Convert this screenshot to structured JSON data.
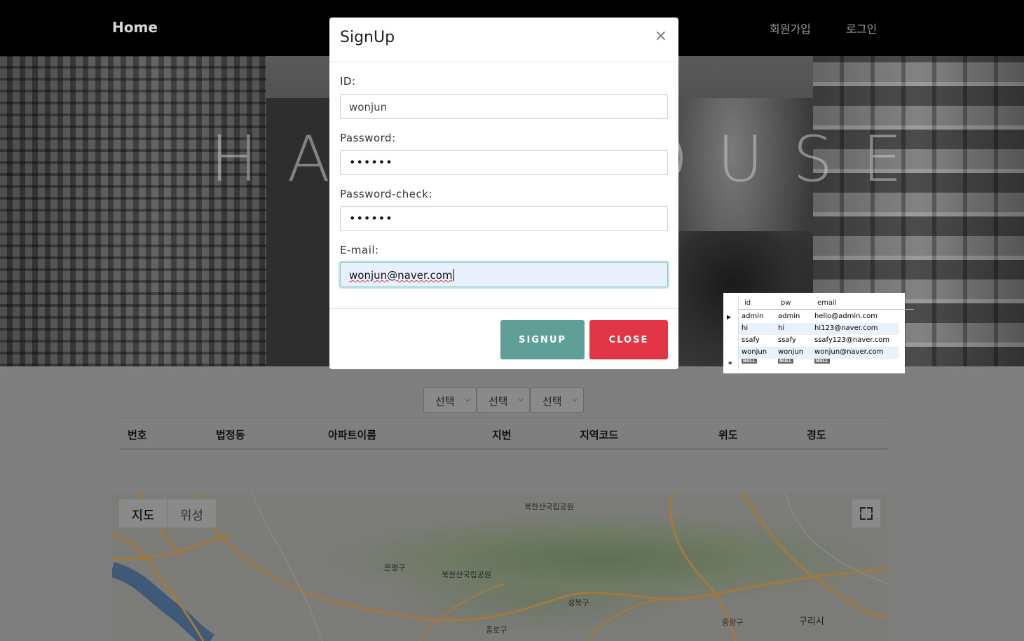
{
  "navbar": {
    "home": "Home",
    "signup": "회원가입",
    "login": "로그인"
  },
  "hero": {
    "title": "HAPPYHOUSE"
  },
  "filters": {
    "select1": "선택",
    "select2": "선택",
    "select3": "선택"
  },
  "table": {
    "headers": [
      "번호",
      "법정동",
      "아파트이름",
      "지번",
      "지역코드",
      "위도",
      "경도"
    ]
  },
  "map": {
    "type_map": "지도",
    "type_satellite": "위성",
    "labels": [
      "북한산국립공원",
      "은평구",
      "북한산국립공원",
      "성북구",
      "종로구",
      "중랑구",
      "구리시"
    ]
  },
  "modal": {
    "title": "SignUp",
    "close_symbol": "×",
    "id_label": "ID:",
    "id_value": "wonjun",
    "password_label": "Password:",
    "password_value": "••••••",
    "password_check_label": "Password-check:",
    "password_check_value": "••••••",
    "email_label": "E-mail:",
    "email_value": "wonjun@naver.com",
    "signup_button": "SIGNUP",
    "close_button": "CLOSE"
  },
  "db_grid": {
    "columns": [
      "id",
      "pw",
      "email"
    ],
    "rows": [
      {
        "id": "admin",
        "pw": "admin",
        "email": "hello@admin.com"
      },
      {
        "id": "hi",
        "pw": "hi",
        "email": "hi123@naver.com"
      },
      {
        "id": "ssafy",
        "pw": "ssafy",
        "email": "ssafy123@naver.com"
      },
      {
        "id": "wonjun",
        "pw": "wonjun",
        "email": "wonjun@naver.com"
      }
    ],
    "null_label": "NULL"
  },
  "colors": {
    "signup_button": "#5f9f98",
    "close_button": "#e23646",
    "navbar": "#000000"
  }
}
